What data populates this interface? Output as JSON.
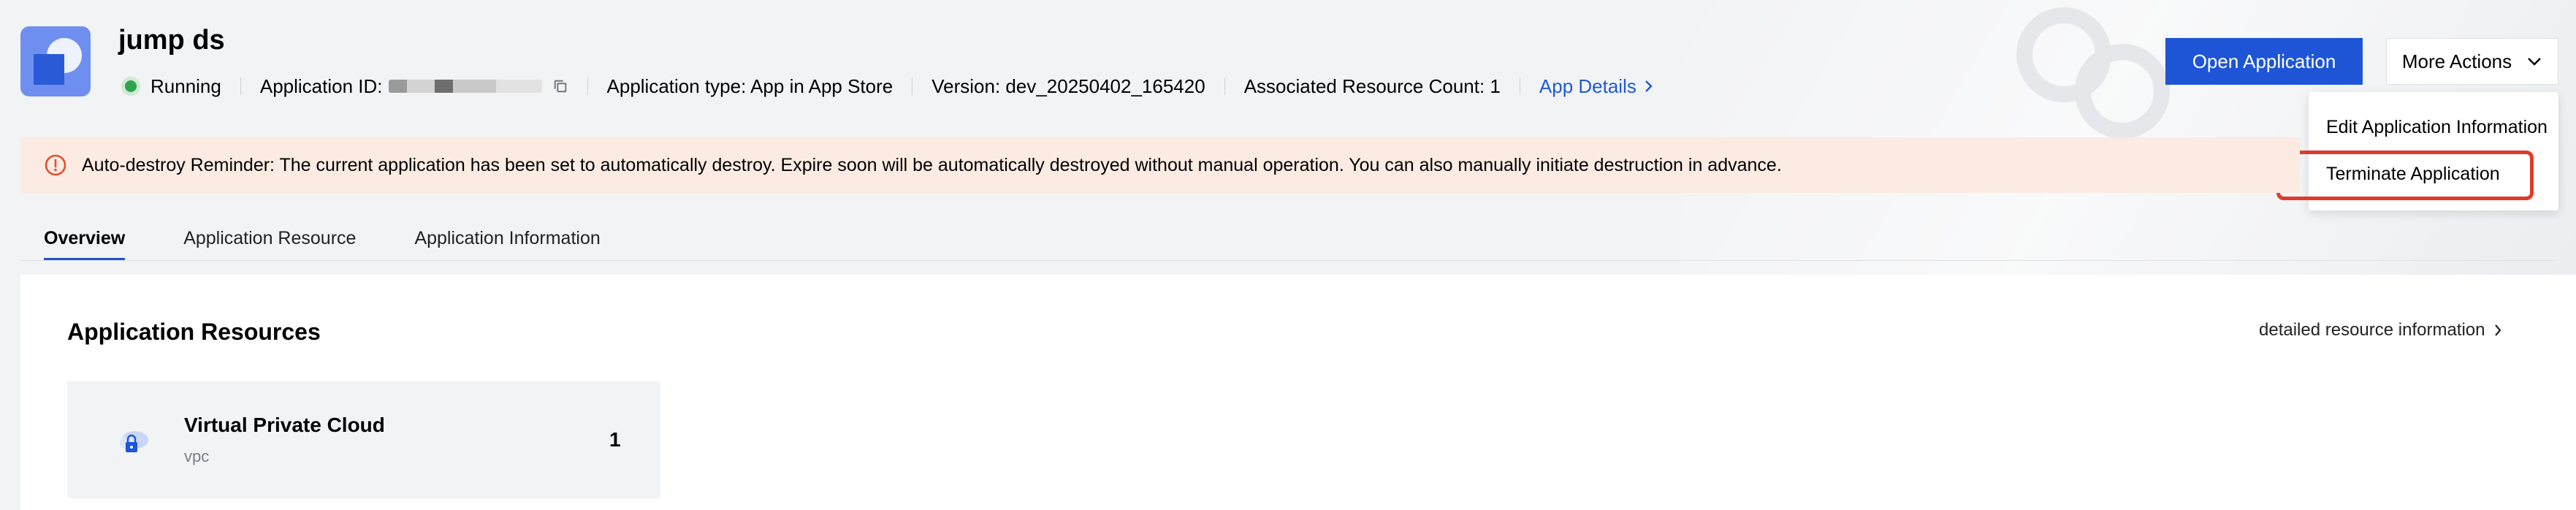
{
  "header": {
    "title": "jump ds",
    "status": "Running",
    "application_id_label": "Application ID:",
    "application_type": "Application type: App in App Store",
    "version": "Version: dev_20250402_165420",
    "resource_count": "Associated Resource Count: 1",
    "details_link": "App Details"
  },
  "actions": {
    "open_application": "Open Application",
    "more_actions": "More Actions",
    "menu": [
      "Edit Application Information",
      "Terminate Application"
    ]
  },
  "banner": {
    "text": "Auto-destroy Reminder: The current application has been set to automatically destroy. Expire soon will be automatically destroyed without manual operation. You can also manually initiate destruction in advance."
  },
  "tabs": [
    "Overview",
    "Application Resource",
    "Application Information"
  ],
  "panel": {
    "title": "Application Resources",
    "detail_link": "detailed resource information",
    "card": {
      "title": "Virtual Private Cloud",
      "subtitle": "vpc",
      "count": "1"
    }
  },
  "colors": {
    "primary": "#1e55d6",
    "highlight": "#e03a2b",
    "banner_bg": "#fbebe2",
    "status": "#2ea44f"
  }
}
